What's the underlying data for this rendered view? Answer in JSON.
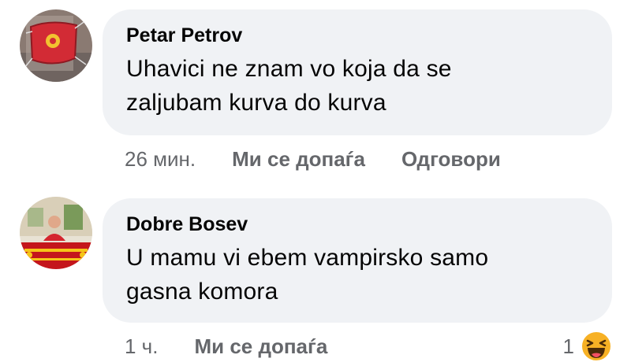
{
  "comments": [
    {
      "author": "Petar Petrov",
      "text_line1": "Uhavici ne znam vo koja da se",
      "text_line2": "zaljubam kurva do kurva",
      "time": "26 мин.",
      "like_label": "Ми се допаѓа",
      "reply_label": "Одговори"
    },
    {
      "author": "Dobre Bosev",
      "text_line1": "U mamu vi ebem vampirsko samo",
      "text_line2": "gasna komora",
      "time": "1 ч.",
      "like_label": "Ми се допаѓа",
      "reaction_count": "1",
      "reaction_icon": "haha-icon"
    }
  ],
  "colors": {
    "bubble": "#f0f2f5",
    "text": "#050505",
    "secondary": "#65676b",
    "haha_yellow": "#f7b125"
  }
}
